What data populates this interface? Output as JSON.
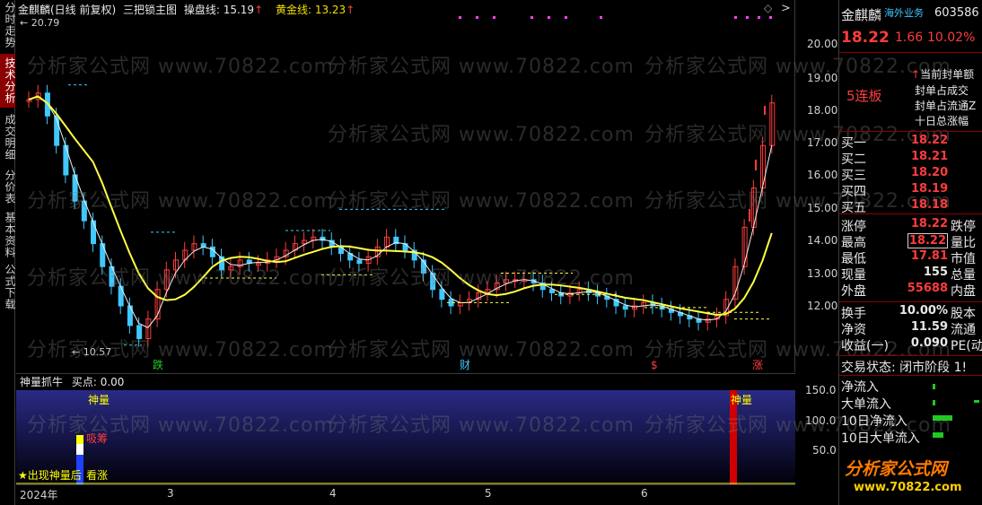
{
  "tabs": [
    "分时走势",
    "技术分析",
    "成交明细",
    "分价表",
    "基本资料",
    "公式下载"
  ],
  "active_tab": 1,
  "chart_title": {
    "stock": "金麒麟(日线 前复权)",
    "indicator": "三把锁主图",
    "line1_label": "操盘线: 15.19",
    "line1_arrow": "↑",
    "line2_label": "黄金线: 13.23",
    "line2_arrow": "↑",
    "diamond": "◇",
    "arrow_right": ">"
  },
  "price_labels": {
    "high": "20.79",
    "low": "10.57"
  },
  "price_axis": [
    "20.00",
    "19.00",
    "18.00",
    "17.00",
    "16.00",
    "15.00",
    "14.00",
    "13.00",
    "12.00"
  ],
  "event_labels": {
    "die": "跌",
    "cai": "财",
    "s": "$",
    "zhang": "涨"
  },
  "indicator_panel": {
    "title": "神量抓牛",
    "buy_point": "买点: 0.00",
    "axis": [
      "150.0",
      "100.0",
      "50.0"
    ],
    "label_shenliang_1": "神量",
    "label_shenliang_2": "神量",
    "label_xichou": "吸筹",
    "caption_left": "★出现神量后",
    "caption_right": "看涨"
  },
  "date_axis": [
    "2024年",
    "3",
    "4",
    "5",
    "6"
  ],
  "right_panel": {
    "name": "金麒麟",
    "sector": "海外业务",
    "code": "603586",
    "price": "18.22",
    "change": "1.66",
    "change_pct": "10.02%",
    "streak": "5连板",
    "limit_items": [
      "当前封单额",
      "封单占成交",
      "封单占流通Z",
      "十日总涨幅"
    ],
    "bids": [
      {
        "label": "买一",
        "price": "18.22"
      },
      {
        "label": "买二",
        "price": "18.21"
      },
      {
        "label": "买三",
        "price": "18.20"
      },
      {
        "label": "买四",
        "price": "18.19"
      },
      {
        "label": "买五",
        "price": "18.18"
      }
    ],
    "stats": [
      {
        "l": "涨停",
        "v": "18.22",
        "r": "跌停"
      },
      {
        "l": "最高",
        "v": "18.22",
        "r": "量比"
      },
      {
        "l": "最低",
        "v": "17.81",
        "r": "市值"
      },
      {
        "l": "现量",
        "v": "155",
        "r": "总量"
      },
      {
        "l": "外盘",
        "v": "55688",
        "r": "内盘"
      }
    ],
    "stats2": [
      {
        "l": "换手",
        "v": "10.00%",
        "r": "股本"
      },
      {
        "l": "净资",
        "v": "11.59",
        "r": "流通"
      },
      {
        "l": "收益(一)",
        "v": "0.090",
        "r": "PE(动"
      }
    ],
    "trade_status": "交易状态: 闭市阶段 1!",
    "flows": [
      "净流入",
      "大单流入",
      "10日净流入",
      "10日大单流入"
    ],
    "footer_brand": "分析家公式网",
    "footer_url": "www.70822.com"
  },
  "watermark": "分析家公式网 www.70822.com",
  "colors": {
    "up": "#ff3c3c",
    "down": "#40c8ff",
    "green": "#22c822",
    "yellow": "#ffff40",
    "magenta": "#ff40ff"
  }
}
